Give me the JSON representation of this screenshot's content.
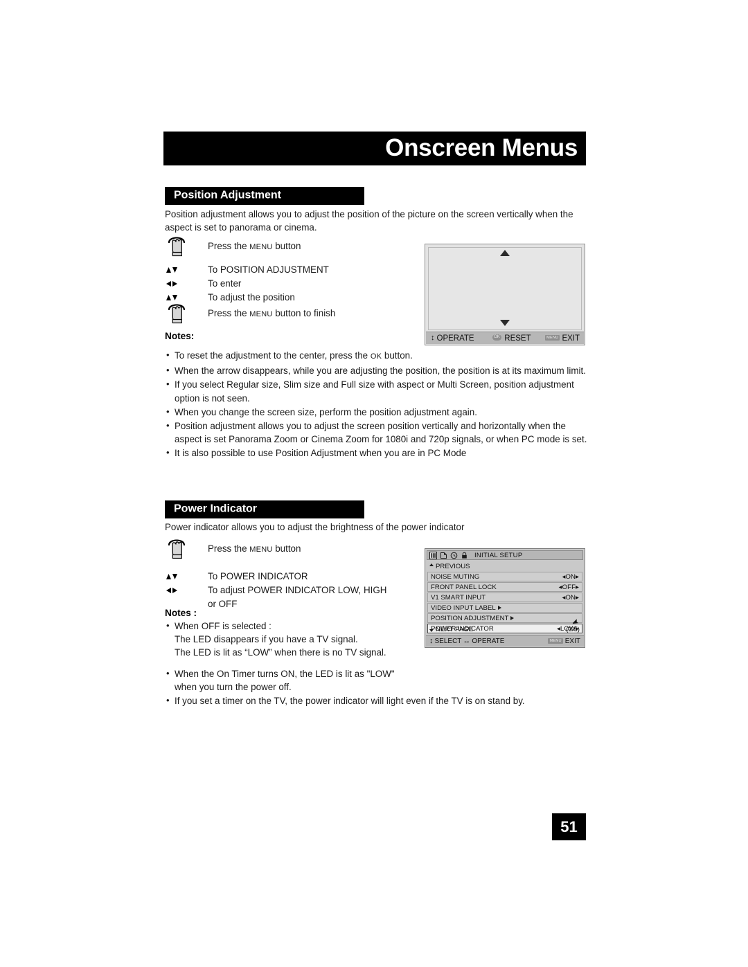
{
  "header": {
    "title": "Onscreen Menus"
  },
  "page_number": "51",
  "sections": {
    "position": {
      "bar_title": "Position Adjustment",
      "intro": "Position adjustment allows you to adjust the position of the picture on the screen vertically when the aspect is set to panorama or cinema.",
      "steps": [
        {
          "icon": "hand-press-icon",
          "pre": "Press the ",
          "sc": "MENU",
          "post": " button"
        },
        {
          "icon": "up-down-arrows-icon",
          "pre": "To POSITION ADJUSTMENT",
          "sc": "",
          "post": ""
        },
        {
          "icon": "left-right-arrows-icon",
          "pre": "To enter",
          "sc": "",
          "post": ""
        },
        {
          "icon": "up-down-arrows-icon",
          "pre": "To adjust the position",
          "sc": "",
          "post": ""
        },
        {
          "icon": "hand-press-icon",
          "pre": "Press the ",
          "sc": "MENU",
          "post": " button to finish"
        }
      ],
      "notes_title": "Notes:",
      "notes": [
        {
          "pre": "To reset the adjustment to the center, press the ",
          "sc": "OK",
          "post": " button."
        },
        {
          "pre": "When the arrow disappears, while you are adjusting the position, the position is at its maximum limit.",
          "sc": "",
          "post": ""
        },
        {
          "pre": "If you select Regular size, Slim size and Full size with aspect or Multi Screen, position adjustment option is not seen.",
          "sc": "",
          "post": ""
        },
        {
          "pre": "When you change the screen size, perform the position adjustment again.",
          "sc": "",
          "post": ""
        },
        {
          "pre": "Position adjustment allows you to adjust the screen position vertically and horizontally when the aspect is set Panorama Zoom or Cinema Zoom for 1080i and 720p signals, or when PC mode is set.",
          "sc": "",
          "post": ""
        },
        {
          "pre": "It is also possible to use Position Adjustment when you are in PC Mode",
          "sc": "",
          "post": ""
        }
      ],
      "osd": {
        "operate_label": "OPERATE",
        "reset_label": "RESET",
        "reset_key": "OK",
        "exit_label": "EXIT",
        "exit_key": "MENU"
      }
    },
    "power": {
      "bar_title": "Power Indicator",
      "intro": "Power indicator allows you to adjust the brightness of the power indicator",
      "steps": [
        {
          "icon": "hand-press-icon",
          "pre": "Press the ",
          "sc": "MENU",
          "post": " button"
        },
        {
          "icon": "up-down-arrows-icon",
          "pre": "To POWER INDICATOR",
          "sc": "",
          "post": ""
        },
        {
          "icon": "left-right-arrows-icon",
          "pre": "To adjust POWER INDICATOR LOW, HIGH",
          "sc": "",
          "post": ""
        },
        {
          "icon": "none",
          "pre": "or OFF",
          "sc": "",
          "post": ""
        }
      ],
      "notes_title": "Notes :",
      "notes": [
        {
          "pre": "When OFF is selected :",
          "sub1": "The LED disappears if you have a TV signal.",
          "sub2": "The LED is lit as “LOW” when there is no TV signal."
        },
        {
          "pre": "When the On Timer turns ON, the LED is lit as \"LOW\" when you turn the power off.",
          "sub1": "",
          "sub2": ""
        },
        {
          "pre": "If you set a timer on the TV, the power indicator will light even if the TV is on stand by.",
          "sub1": "",
          "sub2": ""
        }
      ],
      "osd": {
        "title": "INITIAL SETUP",
        "icons": [
          "picture-bars-icon",
          "page-icon",
          "clock-icon",
          "lock-icon"
        ],
        "previous_label": "PREVIOUS",
        "rows": [
          {
            "label": "NOISE MUTING",
            "value": "ON",
            "type": "value"
          },
          {
            "label": "FRONT PANEL LOCK",
            "value": "OFF",
            "type": "value"
          },
          {
            "label": "V1 SMART INPUT",
            "value": "ON",
            "type": "value"
          },
          {
            "label": "VIDEO INPUT LABEL",
            "value": "",
            "type": "submenu"
          },
          {
            "label": "POSITION ADJUSTMENT",
            "value": "",
            "type": "submenu"
          },
          {
            "label": "POWER INDICATOR",
            "value": "LOW",
            "type": "value",
            "selected": true
          }
        ],
        "next_page_label": "NEXT PAGE",
        "page_indicator": "(2/5)",
        "select_label": "SELECT",
        "operate_label": "OPERATE",
        "exit_label": "EXIT",
        "exit_key": "MENU"
      }
    }
  }
}
